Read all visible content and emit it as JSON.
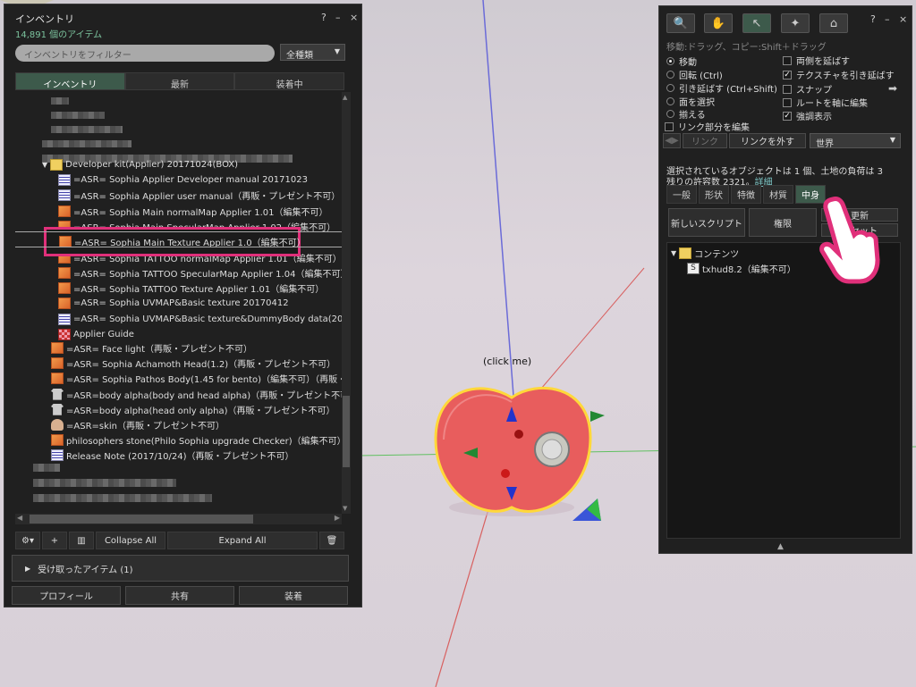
{
  "inventory": {
    "title": "インベントリ",
    "item_count": "14,891 個のアイテム",
    "filter_placeholder": "インベントリをフィルター",
    "type_select": "全種類",
    "tabs": [
      "インベントリ",
      "最新",
      "装着中"
    ],
    "folder_label": "Developer kit(Applier) 20171024(BOX)",
    "items": [
      {
        "icon": "notecard-icon",
        "label": "=ASR= Sophia Applier Developer manual 20171023"
      },
      {
        "icon": "notecard-icon",
        "label": "=ASR= Sophia Applier user manual（再販・プレゼント不可）"
      },
      {
        "icon": "box-icon",
        "label": "=ASR= Sophia Main normalMap Applier 1.01（編集不可）"
      },
      {
        "icon": "box-icon",
        "label": "=ASR= Sophia Main SpecularMap Applier 1.02（編集不可）"
      },
      {
        "icon": "box-icon",
        "label": "=ASR= Sophia Main Texture Applier 1.0（編集不可）"
      },
      {
        "icon": "box-icon",
        "label": "=ASR= Sophia TATTOO normalMap Applier 1.01（編集不可）"
      },
      {
        "icon": "box-icon",
        "label": "=ASR= Sophia TATTOO SpecularMap Applier 1.04（編集不可）"
      },
      {
        "icon": "box-icon",
        "label": "=ASR= Sophia TATTOO Texture Applier 1.01（編集不可）"
      },
      {
        "icon": "box-icon",
        "label": "=ASR= Sophia UVMAP&Basic texture 20170412"
      },
      {
        "icon": "notecard-icon",
        "label": "=ASR= Sophia UVMAP&Basic texture&DummyBody data(20170"
      },
      {
        "icon": "texture-icon",
        "label": "Applier Guide"
      }
    ],
    "items2": [
      {
        "icon": "box-icon",
        "label": "=ASR= Face light（再販・プレゼント不可）"
      },
      {
        "icon": "box-icon",
        "label": "=ASR= Sophia Achamoth Head(1.2)（再販・プレゼント不可）"
      },
      {
        "icon": "box-icon",
        "label": "=ASR= Sophia Pathos Body(1.45 for bento)（編集不可）（再販・プレゼ"
      },
      {
        "icon": "shirt-icon",
        "label": "=ASR=body alpha(body and head alpha)（再販・プレゼント不可）"
      },
      {
        "icon": "shirt-icon",
        "label": "=ASR=body alpha(head only alpha)（再販・プレゼント不可）"
      },
      {
        "icon": "skin-icon",
        "label": "=ASR=skin（再販・プレゼント不可）"
      },
      {
        "icon": "box-icon",
        "label": "philosophers stone(Philo Sophia upgrade Checker)（編集不可）（"
      },
      {
        "icon": "notecard-icon",
        "label": "Release Note (2017/10/24)（再販・プレゼント不可）"
      }
    ],
    "collapse_all": "Collapse All",
    "expand_all": "Expand All",
    "received": "受け取ったアイテム (1)",
    "bottom_buttons": [
      "プロフィール",
      "共有",
      "装着"
    ]
  },
  "build": {
    "hint": "移動:ドラッグ、コピー:Shift＋ドラッグ",
    "radios": [
      {
        "label": "移動",
        "on": true
      },
      {
        "label": "回転 (Ctrl)",
        "on": false
      },
      {
        "label": "引き延ばす (Ctrl+Shift)",
        "on": false
      },
      {
        "label": "面を選択",
        "on": false
      }
    ],
    "align": "揃える",
    "edit_linked": "リンク部分を編集",
    "checks": [
      {
        "label": "両側を延ばす",
        "on": false
      },
      {
        "label": "テクスチャを引き延ばす",
        "on": true
      },
      {
        "label": "スナップ",
        "on": false
      },
      {
        "label": "ルートを軸に編集",
        "on": false
      },
      {
        "label": "強調表示",
        "on": true
      }
    ],
    "link": "リンク",
    "unlink": "リンクを外す",
    "coord": "世界",
    "info_line1": "選択されているオブジェクトは 1 個、土地の負荷は 3",
    "info_line2": "残りの許容数 2321。",
    "more": "詳細",
    "tabs": [
      "一般",
      "形状",
      "特徴",
      "材質",
      "中身"
    ],
    "new_script": "新しいスクリプト",
    "permissions": "権限",
    "refresh": "更新",
    "reset": "リセット",
    "contents_folder": "コンテンツ",
    "contents_item": "txhud8.2（編集不可）"
  },
  "scene": {
    "click_me": "(click me)"
  }
}
